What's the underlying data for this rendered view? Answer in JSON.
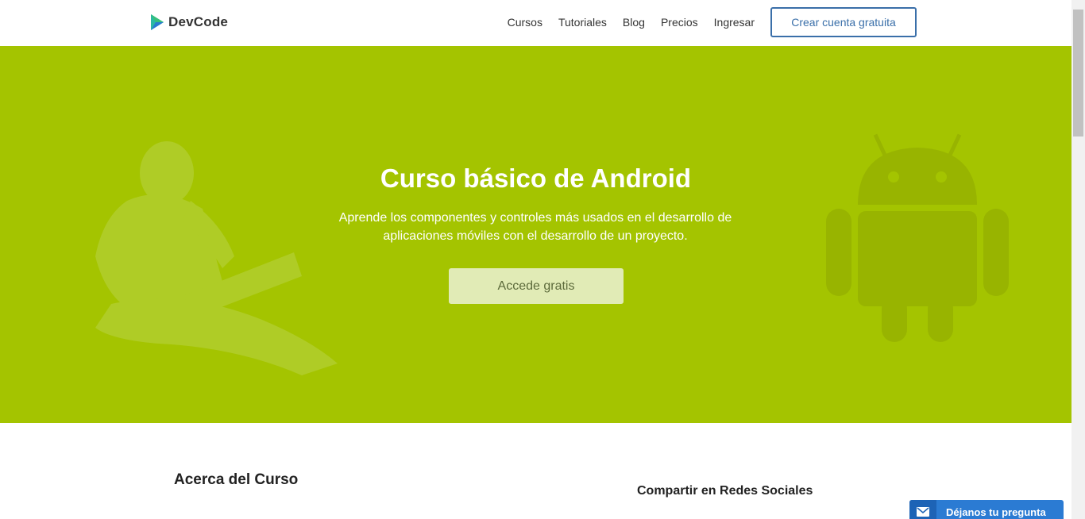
{
  "header": {
    "logo_text": "DevCode",
    "nav": [
      "Cursos",
      "Tutoriales",
      "Blog",
      "Precios",
      "Ingresar"
    ],
    "cta_label": "Crear cuenta gratuita"
  },
  "hero": {
    "title": "Curso básico de Android",
    "subtitle": "Aprende los componentes y controles más usados en el desarrollo de aplicaciones móviles con el desarrollo de un proyecto.",
    "button_label": "Accede gratis",
    "background_color": "#a4c400"
  },
  "content": {
    "about_title": "Acerca del Curso",
    "share_title": "Compartir en Redes Sociales"
  },
  "contact_widget": {
    "label": "Déjanos tu pregunta",
    "icon": "envelope-icon"
  },
  "colors": {
    "accent": "#3a6fa9",
    "widget": "#2b7bd3"
  }
}
